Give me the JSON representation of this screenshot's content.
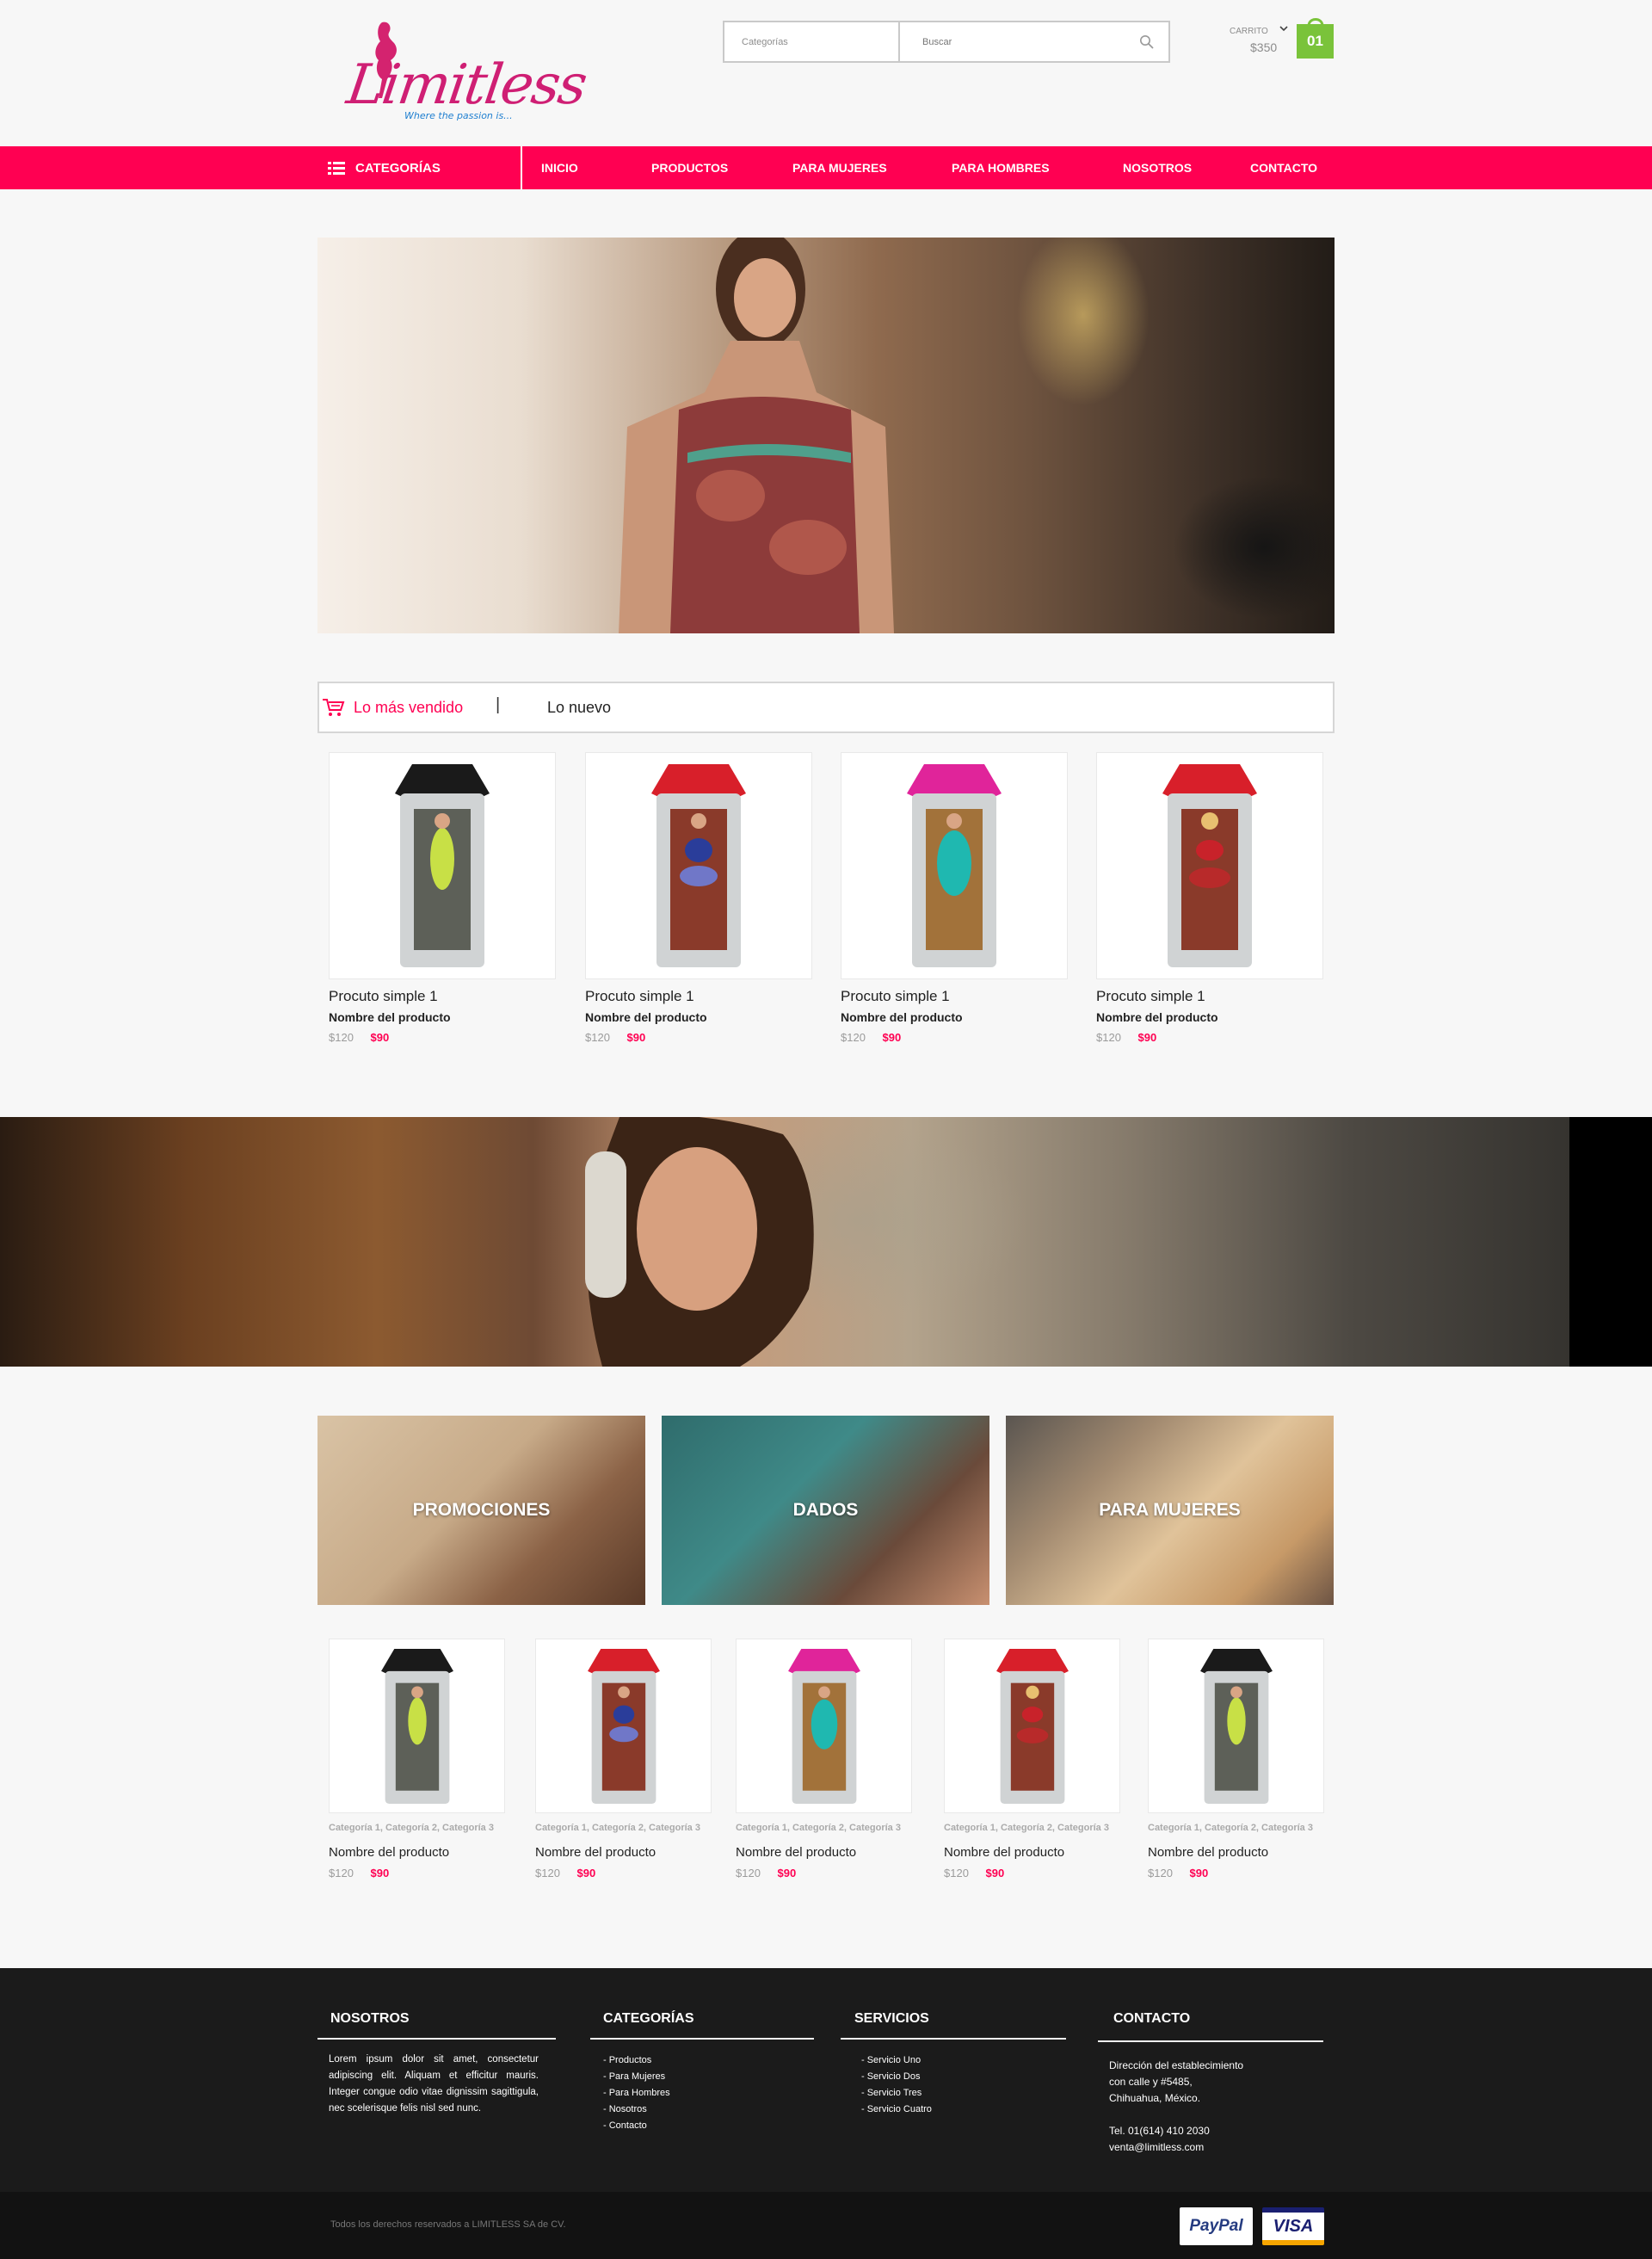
{
  "brand": {
    "name": "Limitless",
    "tagline": "Where the passion is..."
  },
  "search": {
    "category_label": "Categorías",
    "placeholder": "Buscar"
  },
  "cart": {
    "label": "CARRITO",
    "total": "$350",
    "count": "01"
  },
  "nav": {
    "categories_label": "CATEGORÍAS",
    "items": [
      "INICIO",
      "PRODUCTOS",
      "PARA MUJERES",
      "PARA HOMBRES",
      "NOSOTROS",
      "CONTACTO"
    ]
  },
  "tabs": {
    "active": "Lo más vendido",
    "separator": "|",
    "other": "Lo nuevo"
  },
  "featured_products": [
    {
      "title": "Procuto simple 1",
      "name": "Nombre del producto",
      "old_price": "$120",
      "price": "$90",
      "package_color": "#1a1a1a"
    },
    {
      "title": "Procuto simple 1",
      "name": "Nombre del producto",
      "old_price": "$120",
      "price": "$90",
      "package_color": "#d81f2a"
    },
    {
      "title": "Procuto simple 1",
      "name": "Nombre del producto",
      "old_price": "$120",
      "price": "$90",
      "package_color": "#e0249a"
    },
    {
      "title": "Procuto simple 1",
      "name": "Nombre del producto",
      "old_price": "$120",
      "price": "$90",
      "package_color": "#d81f2a"
    }
  ],
  "category_tiles": [
    "PROMOCIONES",
    "DADOS",
    "PARA MUJERES"
  ],
  "grid_products": [
    {
      "categories": "Categoría 1, Categoría 2, Categoría 3",
      "name": "Nombre del producto",
      "old_price": "$120",
      "price": "$90",
      "package_color": "#1a1a1a"
    },
    {
      "categories": "Categoría 1, Categoría 2, Categoría 3",
      "name": "Nombre del producto",
      "old_price": "$120",
      "price": "$90",
      "package_color": "#d81f2a"
    },
    {
      "categories": "Categoría 1, Categoría 2, Categoría 3",
      "name": "Nombre del producto",
      "old_price": "$120",
      "price": "$90",
      "package_color": "#e0249a"
    },
    {
      "categories": "Categoría 1, Categoría 2, Categoría 3",
      "name": "Nombre del producto",
      "old_price": "$120",
      "price": "$90",
      "package_color": "#d81f2a"
    },
    {
      "categories": "Categoría 1, Categoría 2, Categoría 3",
      "name": "Nombre del producto",
      "old_price": "$120",
      "price": "$90",
      "package_color": "#1a1a1a"
    }
  ],
  "footer": {
    "nosotros": {
      "title": "NOSOTROS",
      "text": "Lorem ipsum dolor sit amet, consectetur adipiscing elit. Aliquam et efficitur mauris. Integer congue odio vitae dignissim sagittigula, nec scelerisque felis nisl sed nunc."
    },
    "categorias": {
      "title": "CATEGORÍAS",
      "items": [
        "- Productos",
        "- Para Mujeres",
        "- Para Hombres",
        "- Nosotros",
        "- Contacto"
      ]
    },
    "servicios": {
      "title": "SERVICIOS",
      "items": [
        "- Servicio  Uno",
        "- Servicio Dos",
        "- Servicio Tres",
        "- Servicio Cuatro"
      ]
    },
    "contacto": {
      "title": "CONTACTO",
      "address_1": "Dirección del establecimiento",
      "address_2": "con calle  y #5485,",
      "address_3": "Chihuahua, México.",
      "phone": "Tel. 01(614) 410 2030",
      "email": "venta@limitless.com"
    },
    "copyright": "Todos los derechos reservados a LIMITLESS SA de CV.",
    "payments": [
      "PayPal",
      "VISA"
    ]
  },
  "colors": {
    "accent": "#ff0052",
    "cart_badge": "#7ac33a",
    "footer_bg": "#1b1b1b"
  }
}
